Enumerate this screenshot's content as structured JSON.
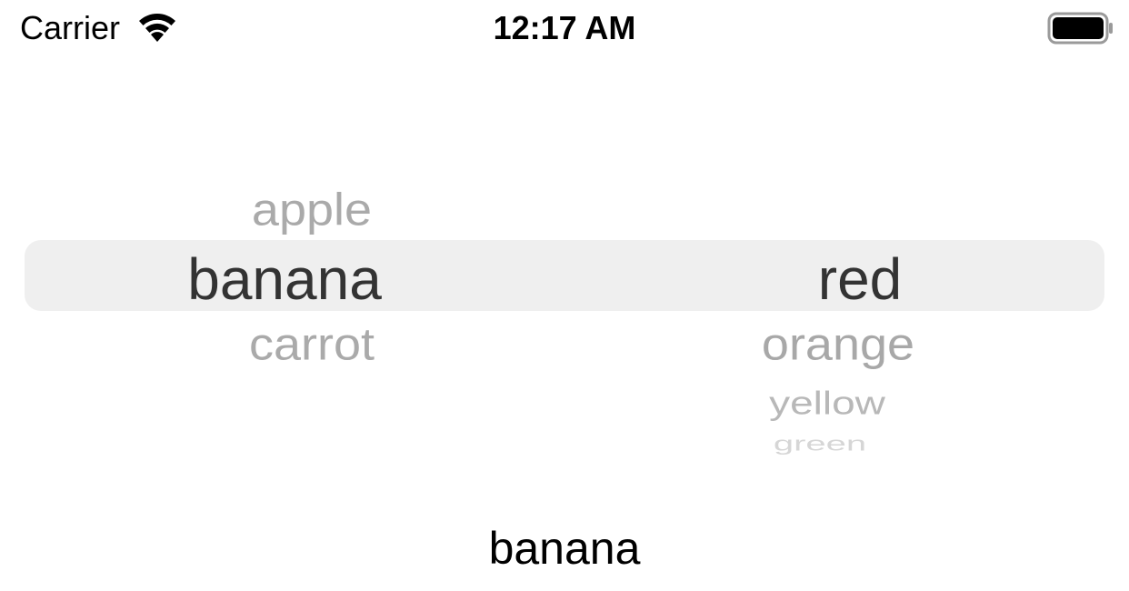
{
  "status_bar": {
    "carrier": "Carrier",
    "time": "12:17 AM",
    "icons": [
      "wifi-icon",
      "battery-icon"
    ]
  },
  "picker": {
    "left_column": {
      "rows": [
        "apple",
        "banana",
        "carrot"
      ],
      "selected": "banana"
    },
    "right_column": {
      "rows": [
        "red",
        "orange",
        "yellow",
        "green"
      ],
      "selected": "red"
    }
  },
  "result_label": "banana",
  "colors": {
    "selection_band": "#efefef",
    "selected_text": "#333333",
    "unselected_text": "#aaaaaa"
  }
}
